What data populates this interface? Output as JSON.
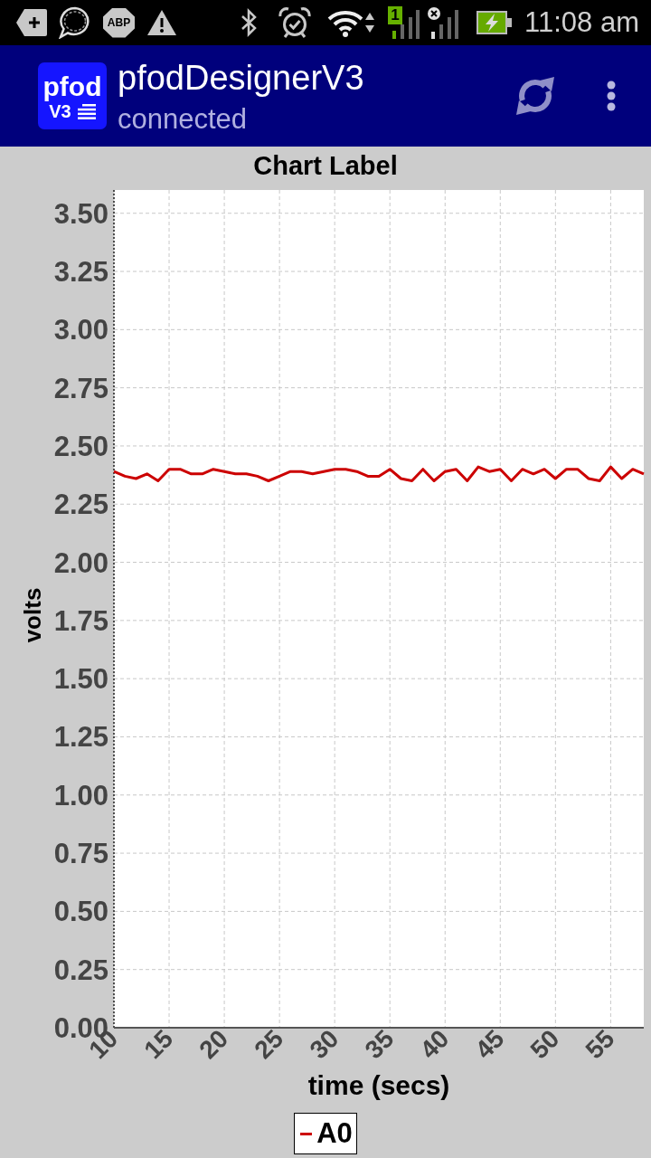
{
  "status_bar": {
    "badge_text": "ABP",
    "sim_slot": "1",
    "time": "11:08 am"
  },
  "app_bar": {
    "logo": {
      "name": "pfod",
      "version": "V3"
    },
    "title": "pfodDesignerV3",
    "subtitle": "connected"
  },
  "chart": {
    "chart_data": {
      "type": "line",
      "title": "Chart Label",
      "xlabel": "time (secs)",
      "ylabel": "volts",
      "grid": true,
      "x": [
        10,
        11,
        12,
        13,
        14,
        15,
        16,
        17,
        18,
        19,
        20,
        21,
        22,
        23,
        24,
        25,
        26,
        27,
        28,
        29,
        30,
        31,
        32,
        33,
        34,
        35,
        36,
        37,
        38,
        39,
        40,
        41,
        42,
        43,
        44,
        45,
        46,
        47,
        48,
        49,
        50,
        51,
        52,
        53,
        54,
        55,
        56,
        57,
        58
      ],
      "series": [
        {
          "name": "A0",
          "color": "#cc0000",
          "values": [
            2.39,
            2.37,
            2.36,
            2.38,
            2.35,
            2.4,
            2.4,
            2.38,
            2.38,
            2.4,
            2.39,
            2.38,
            2.38,
            2.37,
            2.35,
            2.37,
            2.39,
            2.39,
            2.38,
            2.39,
            2.4,
            2.4,
            2.39,
            2.37,
            2.37,
            2.4,
            2.36,
            2.35,
            2.4,
            2.35,
            2.39,
            2.4,
            2.35,
            2.41,
            2.39,
            2.4,
            2.35,
            2.4,
            2.38,
            2.4,
            2.36,
            2.4,
            2.4,
            2.36,
            2.35,
            2.41,
            2.36,
            2.4,
            2.38
          ]
        }
      ],
      "xlim": [
        10,
        58
      ],
      "ylim": [
        0,
        3.6
      ],
      "xticks": [
        10,
        15,
        20,
        25,
        30,
        35,
        40,
        45,
        50,
        55
      ],
      "yticks": [
        {
          "value": 0,
          "label": "0.00"
        },
        {
          "value": 0.25,
          "label": "0.25"
        },
        {
          "value": 0.5,
          "label": "0.50"
        },
        {
          "value": 0.75,
          "label": "0.75"
        },
        {
          "value": 1,
          "label": "1.00"
        },
        {
          "value": 1.25,
          "label": "1.25"
        },
        {
          "value": 1.5,
          "label": "1.50"
        },
        {
          "value": 1.75,
          "label": "1.75"
        },
        {
          "value": 2,
          "label": "2.00"
        },
        {
          "value": 2.25,
          "label": "2.25"
        },
        {
          "value": 2.5,
          "label": "2.50"
        },
        {
          "value": 2.75,
          "label": "2.75"
        },
        {
          "value": 3,
          "label": "3.00"
        },
        {
          "value": 3.25,
          "label": "3.25"
        },
        {
          "value": 3.5,
          "label": "3.50"
        }
      ]
    }
  }
}
